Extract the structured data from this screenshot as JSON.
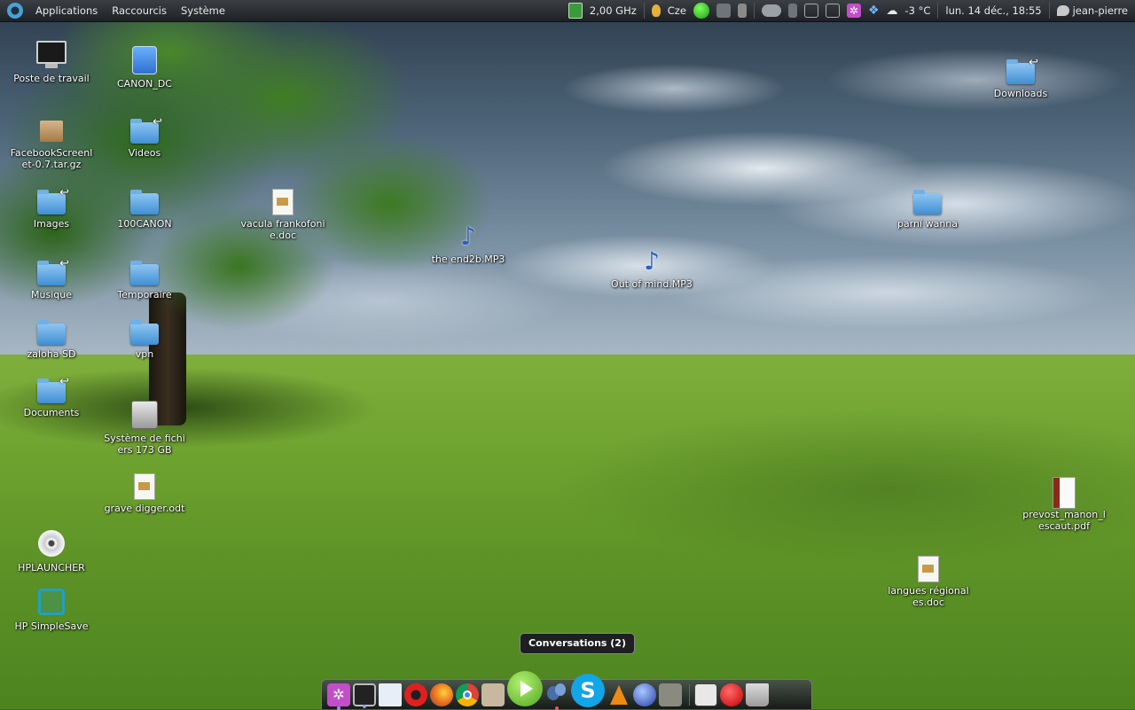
{
  "top_panel": {
    "menus": [
      "Applications",
      "Raccourcis",
      "Système"
    ],
    "cpu_freq": "2,00 GHz",
    "keyboard_layout": "Cze",
    "weather": "-3 °C",
    "datetime": "lun. 14 déc., 18:55",
    "user": "jean-pierre"
  },
  "desktop_icons": [
    {
      "label": "Poste de travail",
      "icon": "computer-icon"
    },
    {
      "label": "CANON_DC",
      "icon": "camera-drive-icon"
    },
    {
      "label": "FacebookScreenlet-0.7.tar.gz",
      "icon": "archive-icon"
    },
    {
      "label": "Videos",
      "icon": "folder-link-icon"
    },
    {
      "label": "Images",
      "icon": "folder-link-icon"
    },
    {
      "label": "100CANON",
      "icon": "folder-icon"
    },
    {
      "label": "vacula frankofonie.doc",
      "icon": "document-icon"
    },
    {
      "label": "the end2b.MP3",
      "icon": "music-icon"
    },
    {
      "label": "Out of mind.MP3",
      "icon": "music-icon"
    },
    {
      "label": "Musique",
      "icon": "folder-link-icon"
    },
    {
      "label": "Temporaire",
      "icon": "folder-icon"
    },
    {
      "label": "zaloha SD",
      "icon": "folder-icon"
    },
    {
      "label": "vpn",
      "icon": "folder-icon"
    },
    {
      "label": "Documents",
      "icon": "folder-link-icon"
    },
    {
      "label": "Système de fichiers 173 GB",
      "icon": "hard-drive-icon"
    },
    {
      "label": "grave digger.odt",
      "icon": "document-icon"
    },
    {
      "label": "HPLAUNCHER",
      "icon": "cd-icon"
    },
    {
      "label": "HP SimpleSave",
      "icon": "hp-simplesave-icon"
    },
    {
      "label": "Downloads",
      "icon": "folder-link-icon"
    },
    {
      "label": "parní wanna",
      "icon": "folder-icon"
    },
    {
      "label": "prevost_manon_lescaut.pdf",
      "icon": "pdf-icon"
    },
    {
      "label": "langues régionales.doc",
      "icon": "document-icon"
    }
  ],
  "tooltip": "Conversations (2)",
  "dock_items": [
    "settings-gear-icon",
    "monitor-icon",
    "text-editor-icon",
    "opera-icon",
    "firefox-icon",
    "chrome-icon",
    "gimp-icon",
    "play-media-icon",
    "conversations-icon",
    "skype-icon",
    "vlc-icon",
    "globe-icon",
    "terminal-icon",
    "columns-icon",
    "record-icon",
    "trash-icon"
  ]
}
